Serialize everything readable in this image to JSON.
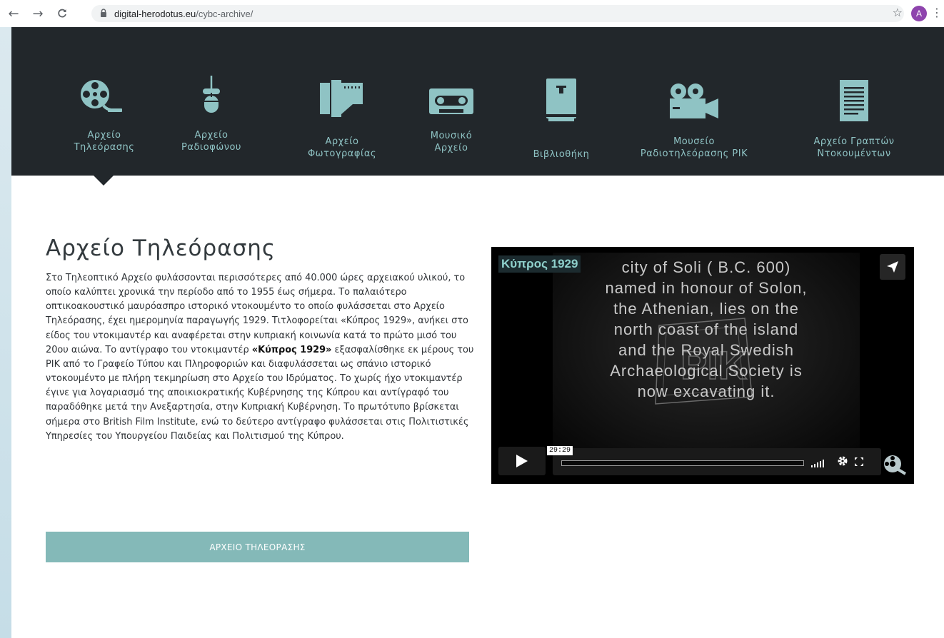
{
  "browser": {
    "back": "←",
    "forward": "→",
    "reload": "C",
    "url_domain": "digital-herodotus.eu",
    "url_path": "/cybc-archive/",
    "avatar_letter": "A"
  },
  "nav": {
    "items": [
      {
        "line1": "Αρχείο",
        "line2": "Τηλεόρασης",
        "icon": "film-reel-icon"
      },
      {
        "line1": "Αρχείο",
        "line2": "Ραδιοφώνου",
        "icon": "microphone-icon"
      },
      {
        "line1": "Αρχείο",
        "line2": "Φωτογραφίας",
        "icon": "film-roll-icon"
      },
      {
        "line1": "Μουσικό",
        "line2": "Αρχείο",
        "icon": "cassette-icon"
      },
      {
        "line1": "Βιβλιοθήκη",
        "line2": "",
        "icon": "book-icon"
      },
      {
        "line1": "Μουσείο",
        "line2": "Ραδιοτηλεόρασης ΡΙΚ",
        "icon": "video-camera-icon"
      },
      {
        "line1": "Αρχείο Γραπτών",
        "line2": "Ντοκουμέντων",
        "icon": "document-icon"
      }
    ],
    "active_index": 0
  },
  "main": {
    "title": "Αρχείο Τηλεόρασης",
    "paragraph_before_bold": "Στο Τηλεοπτικό Αρχείο φυλάσσονται περισσότερες από 40.000 ώρες αρχειακού υλικού, το οποίο καλύπτει χρονικά την περίοδο από το 1955 έως σήμερα. Το παλαιότερο οπτικοακουστικό μαυρόασπρο ιστορικό ντοκουμέντο το οποίο φυλάσσεται στο Αρχείο Τηλεόρασης, έχει ημερομηνία παραγωγής 1929. Τιτλοφορείται «Κύπρος 1929», ανήκει στο είδος του ντοκιμαντέρ και αναφέρεται στην κυπριακή κοινωνία κατά το πρώτο μισό του 20ου αιώνα. Το αντίγραφο του ντοκιμαντέρ ",
    "paragraph_bold": "«Κύπρος 1929»",
    "paragraph_after_bold": " εξασφαλίσθηκε εκ μέρους του ΡΙΚ από το Γραφείο Τύπου και Πληροφοριών και διαφυλάσσεται ως σπάνιο ιστορικό ντοκουμέντο με πλήρη τεκμηρίωση στο Αρχείο του Ιδρύματος. Το χωρίς ήχο ντοκιμαντέρ έγινε για λογαριασμό της αποικιοκρατικής Κυβέρνησης της Κύπρου και αντίγραφό του παραδόθηκε μετά την Ανεξαρτησία, στην Κυπριακή Κυβέρνηση. Το πρωτότυπο βρίσκεται σήμερα στο British Film Institute, ενώ το δεύτερο αντίγραφο φυλάσσεται στις Πολιτιστικές Υπηρεσίες του Υπουργείου Παιδείας και Πολιτισμού της Κύπρου.",
    "button_label": "ΑΡΧΕΙΟ ΤΗΛΕΟΡΑΣΗΣ"
  },
  "video": {
    "title": "Κύπρος 1929",
    "film_lines": [
      "city  of  Soli ( B.C. 600)",
      "named in honour of Solon,",
      "the Athenian,  lies on the",
      "north coast of the island",
      "and  the  Royal  Swedish",
      "Archaeological  Society  is",
      "now  excavating  it."
    ],
    "duration": "29:29",
    "progress_fraction": 0
  },
  "colors": {
    "nav_bg": "#22272b",
    "nav_text": "#8fc3c4",
    "button_bg": "#84b9b8",
    "video_title_text": "#8fd0cc"
  }
}
